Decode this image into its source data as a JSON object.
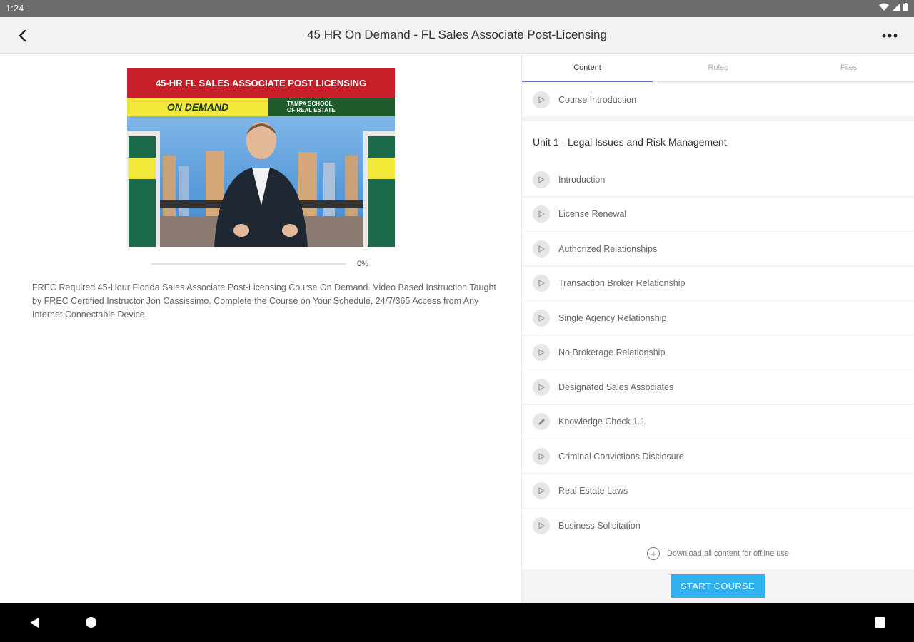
{
  "status_bar": {
    "time": "1:24"
  },
  "app_bar": {
    "title": "45 HR On Demand - FL Sales Associate Post-Licensing"
  },
  "course": {
    "thumbnail": {
      "banner_top": "45-HR FL SALES ASSOCIATE POST LICENSING",
      "banner_left": "ON DEMAND",
      "banner_right_line1": "TAMPA SCHOOL",
      "banner_right_line2": "OF REAL ESTATE"
    },
    "progress": 0,
    "progress_label": "0%",
    "description": "FREC Required 45-Hour Florida Sales Associate Post-Licensing Course On Demand. Video Based Instruction Taught by FREC Certified Instructor Jon Cassissimo. Complete the Course on Your Schedule, 24/7/365 Access from Any Internet Connectable Device."
  },
  "tabs": [
    {
      "label": "Content",
      "active": true
    },
    {
      "label": "Rules",
      "active": false
    },
    {
      "label": "Files",
      "active": false
    }
  ],
  "content_list": {
    "intro_item": {
      "label": "Course Introduction",
      "icon": "play-icon"
    },
    "unit_title": "Unit 1 - Legal Issues and Risk Management",
    "items": [
      {
        "label": "Introduction",
        "icon": "play-icon"
      },
      {
        "label": "License Renewal",
        "icon": "play-icon"
      },
      {
        "label": "Authorized Relationships",
        "icon": "play-icon"
      },
      {
        "label": "Transaction Broker Relationship",
        "icon": "play-icon"
      },
      {
        "label": "Single Agency Relationship",
        "icon": "play-icon"
      },
      {
        "label": "No Brokerage Relationship",
        "icon": "play-icon"
      },
      {
        "label": "Designated Sales Associates",
        "icon": "play-icon"
      },
      {
        "label": "Knowledge Check 1.1",
        "icon": "pencil-icon"
      },
      {
        "label": "Criminal Convictions Disclosure",
        "icon": "play-icon"
      },
      {
        "label": "Real Estate Laws",
        "icon": "play-icon"
      },
      {
        "label": "Business Solicitation",
        "icon": "play-icon"
      }
    ]
  },
  "download_label": "Download all content for offline use",
  "start_button_label": "START COURSE",
  "colors": {
    "accent": "#2eb1ee",
    "tab_indicator": "#5b7fc4",
    "banner_red": "#c8202a",
    "banner_yellow": "#f2e83a",
    "banner_green": "#1e5a2a"
  }
}
